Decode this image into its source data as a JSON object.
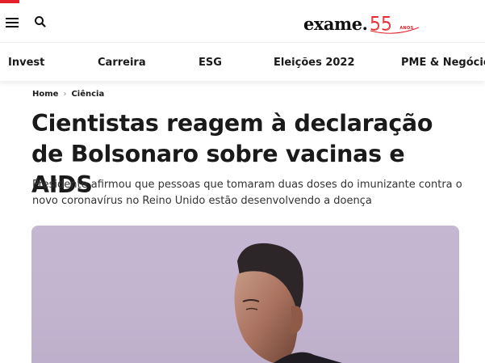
{
  "header": {
    "logo_text": "exame.",
    "logo_anniversary_number": "55",
    "logo_anniversary_label": "ANOS",
    "accent_color": "#e4202a"
  },
  "nav": {
    "items": [
      {
        "label": "Invest"
      },
      {
        "label": "Carreira"
      },
      {
        "label": "ESG"
      },
      {
        "label": "Eleições 2022"
      },
      {
        "label": "PME & Negócios"
      }
    ]
  },
  "breadcrumb": {
    "home": "Home",
    "section": "Ciência"
  },
  "article": {
    "title": "Cientistas reagem à declaração de Bolsonaro sobre vacinas e AIDS",
    "summary": "Presidente afirmou que pessoas que tomaram duas doses do imunizante contra o novo coronavírus no Reino Unido estão desenvolvendo a doença"
  }
}
